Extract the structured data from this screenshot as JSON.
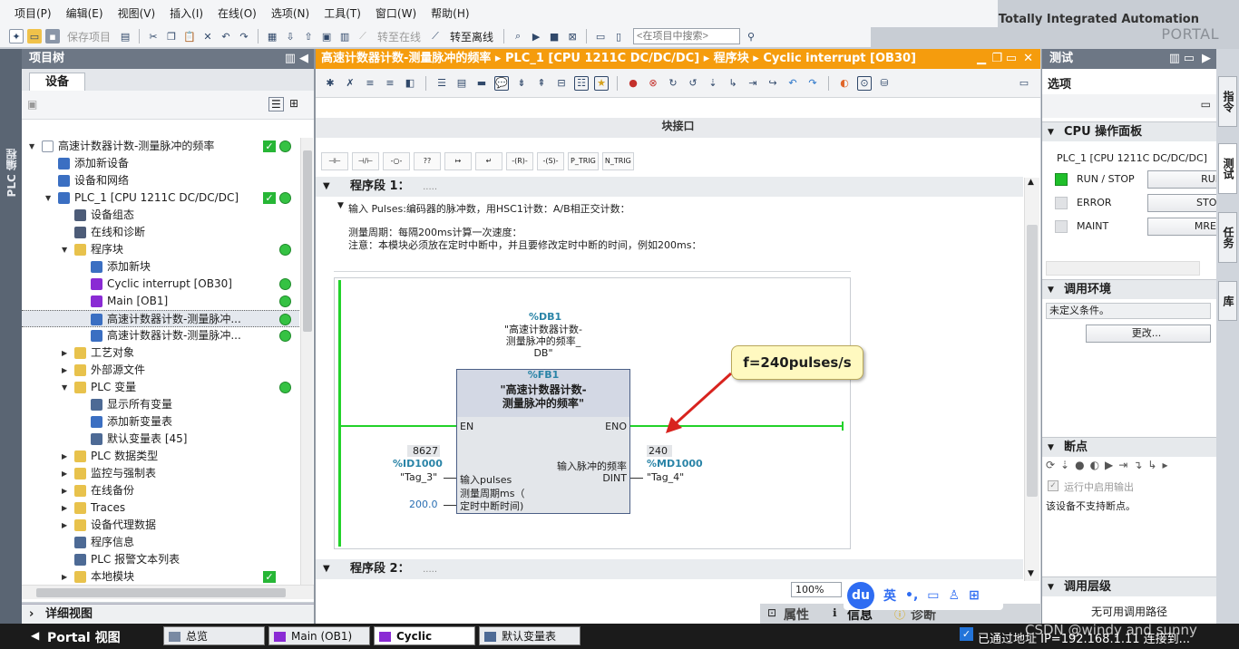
{
  "menu": [
    "项目(P)",
    "编辑(E)",
    "视图(V)",
    "插入(I)",
    "在线(O)",
    "选项(N)",
    "工具(T)",
    "窗口(W)",
    "帮助(H)"
  ],
  "brand": {
    "line1": "Totally Integrated Automation",
    "line2": "PORTAL"
  },
  "toolbar": {
    "save_project": "保存项目",
    "go_online": "转至在线",
    "go_offline": "转至离线",
    "search_placeholder": "<在项目中搜索>"
  },
  "sidebar_tab": "PLC 编程",
  "project_tree": {
    "title": "项目树",
    "devices_tab": "设备",
    "items": [
      {
        "label": "高速计数器计数-测量脉冲的频率",
        "level": 0,
        "arrow": "▼",
        "icon": "project-icon",
        "check": true,
        "status": true
      },
      {
        "label": "添加新设备",
        "level": 1,
        "arrow": "",
        "icon": "add-device-icon",
        "check": false,
        "status": false
      },
      {
        "label": "设备和网络",
        "level": 1,
        "arrow": "",
        "icon": "network-icon",
        "check": false,
        "status": false
      },
      {
        "label": "PLC_1 [CPU 1211C DC/DC/DC]",
        "level": 1,
        "arrow": "▼",
        "icon": "plc-icon",
        "check": true,
        "status": true
      },
      {
        "label": "设备组态",
        "level": 2,
        "arrow": "",
        "icon": "device-config-icon",
        "check": false,
        "status": false
      },
      {
        "label": "在线和诊断",
        "level": 2,
        "arrow": "",
        "icon": "diagnostics-icon",
        "check": false,
        "status": false
      },
      {
        "label": "程序块",
        "level": 2,
        "arrow": "▼",
        "icon": "folder-icon",
        "check": false,
        "status": true
      },
      {
        "label": "添加新块",
        "level": 3,
        "arrow": "",
        "icon": "add-block-icon",
        "check": false,
        "status": false
      },
      {
        "label": "Cyclic interrupt [OB30]",
        "level": 3,
        "arrow": "",
        "icon": "ob-icon",
        "check": false,
        "status": true
      },
      {
        "label": "Main [OB1]",
        "level": 3,
        "arrow": "",
        "icon": "ob-icon",
        "check": false,
        "status": true
      },
      {
        "label": "高速计数器计数-测量脉冲...",
        "level": 3,
        "arrow": "",
        "icon": "fb-icon",
        "check": false,
        "status": true,
        "selected": true
      },
      {
        "label": "高速计数器计数-测量脉冲...",
        "level": 3,
        "arrow": "",
        "icon": "db-icon",
        "check": false,
        "status": true
      },
      {
        "label": "工艺对象",
        "level": 2,
        "arrow": "▶",
        "icon": "folder-icon",
        "check": false,
        "status": false
      },
      {
        "label": "外部源文件",
        "level": 2,
        "arrow": "▶",
        "icon": "folder-icon",
        "check": false,
        "status": false
      },
      {
        "label": "PLC 变量",
        "level": 2,
        "arrow": "▼",
        "icon": "folder-icon",
        "check": false,
        "status": true
      },
      {
        "label": "显示所有变量",
        "level": 3,
        "arrow": "",
        "icon": "tag-table-icon",
        "check": false,
        "status": false
      },
      {
        "label": "添加新变量表",
        "level": 3,
        "arrow": "",
        "icon": "add-tag-icon",
        "check": false,
        "status": false
      },
      {
        "label": "默认变量表 [45]",
        "level": 3,
        "arrow": "",
        "icon": "tag-table-icon",
        "check": false,
        "status": false
      },
      {
        "label": "PLC 数据类型",
        "level": 2,
        "arrow": "▶",
        "icon": "folder-icon",
        "check": false,
        "status": false
      },
      {
        "label": "监控与强制表",
        "level": 2,
        "arrow": "▶",
        "icon": "folder-icon",
        "check": false,
        "status": false
      },
      {
        "label": "在线备份",
        "level": 2,
        "arrow": "▶",
        "icon": "folder-icon",
        "check": false,
        "status": false
      },
      {
        "label": "Traces",
        "level": 2,
        "arrow": "▶",
        "icon": "folder-icon",
        "check": false,
        "status": false
      },
      {
        "label": "设备代理数据",
        "level": 2,
        "arrow": "▶",
        "icon": "folder-icon",
        "check": false,
        "status": false
      },
      {
        "label": "程序信息",
        "level": 2,
        "arrow": "",
        "icon": "info-icon",
        "check": false,
        "status": false
      },
      {
        "label": "PLC 报警文本列表",
        "level": 2,
        "arrow": "",
        "icon": "alarm-icon",
        "check": false,
        "status": false
      },
      {
        "label": "本地模块",
        "level": 2,
        "arrow": "▶",
        "icon": "folder-icon",
        "check": true,
        "status": false
      }
    ]
  },
  "detail_view": "详细视图",
  "editor": {
    "title": "高速计数器计数-测量脉冲的频率 ▸ PLC_1 [CPU 1211C DC/DC/DC] ▸ 程序块 ▸ Cyclic interrupt [OB30]",
    "block_interface": "块接口",
    "ladder": [
      "⊣⊢",
      "⊣/⊢",
      "-○-",
      "??",
      "↦",
      "↵",
      "-(R)-",
      "-(S)-",
      "P_TRIG",
      "N_TRIG"
    ],
    "network1": "程序段 1：",
    "network1_dots": ".....",
    "comment1": "输入 Pulses:编码器的脉冲数，用HSC1计数：A/B相正交计数：",
    "comment2a": "测量周期：每隔200ms计算一次速度：",
    "comment2b": "注意：本模块必须放在定时中断中，并且要修改定时中断的时间，例如200ms：",
    "db_name": "%DB1",
    "db_label1": "\"高速计数器计数-",
    "db_label2": "测量脉冲的频率_",
    "db_label3": "DB\"",
    "fb_name": "%FB1",
    "fb_title1": "\"高速计数器计数-",
    "fb_title2": "测量脉冲的频率\"",
    "en": "EN",
    "eno": "ENO",
    "in_value": "8627",
    "in_addr": "%ID1000",
    "in_tag": "\"Tag_3\"",
    "in_pin": "输入pulses",
    "period_pin1": "测量周期ms（",
    "period_pin2": "定时中断时间)",
    "period_value": "200.0",
    "out_pin": "输入脉冲的频率",
    "out_type": "DINT",
    "out_value": "240",
    "out_addr": "%MD1000",
    "out_tag": "\"Tag_4\"",
    "network2": "程序段 2：",
    "network2_dots": ".....",
    "zoom": "100%",
    "properties": "属性",
    "info": "信息",
    "diagnostics": "诊断"
  },
  "callout": "f=240pulses/s",
  "right_panel": {
    "title": "测试",
    "options": "选项",
    "cpu_panel": "CPU 操作面板",
    "cpu_name": "PLC_1 [CPU 1211C DC/DC/DC]",
    "run_stop": "RUN / STOP",
    "error": "ERROR",
    "maint": "MAINT",
    "run_btn": "RUN",
    "stop_btn": "STOP",
    "mres_btn": "MRES",
    "call_env": "调用环境",
    "undefined_cond": "未定义条件。",
    "change_btn": "更改...",
    "breakpoints": "断点",
    "enable_output": "运行中启用输出",
    "no_breakpoints": "该设备不支持断点。",
    "call_hierarchy": "调用层级",
    "no_call_path": "无可用调用路径"
  },
  "right_tabs": [
    "指令",
    "测试",
    "任务",
    "库"
  ],
  "taskbar": {
    "portal": "Portal 视图",
    "tasks": [
      "总览",
      "Main (OB1)",
      "Cyclic interr...",
      "默认变量表"
    ],
    "status": "已通过地址 IP=192.168.1.11 连接到..."
  },
  "ime": {
    "logo": "du",
    "lang": "英"
  },
  "watermark": "CSDN @windy and sunny",
  "colors": {
    "accent": "#f59c0d",
    "panel_header": "#6d7785",
    "power_flow": "#22d22a",
    "addr": "#2a84a7",
    "status_ok": "#35c243"
  }
}
